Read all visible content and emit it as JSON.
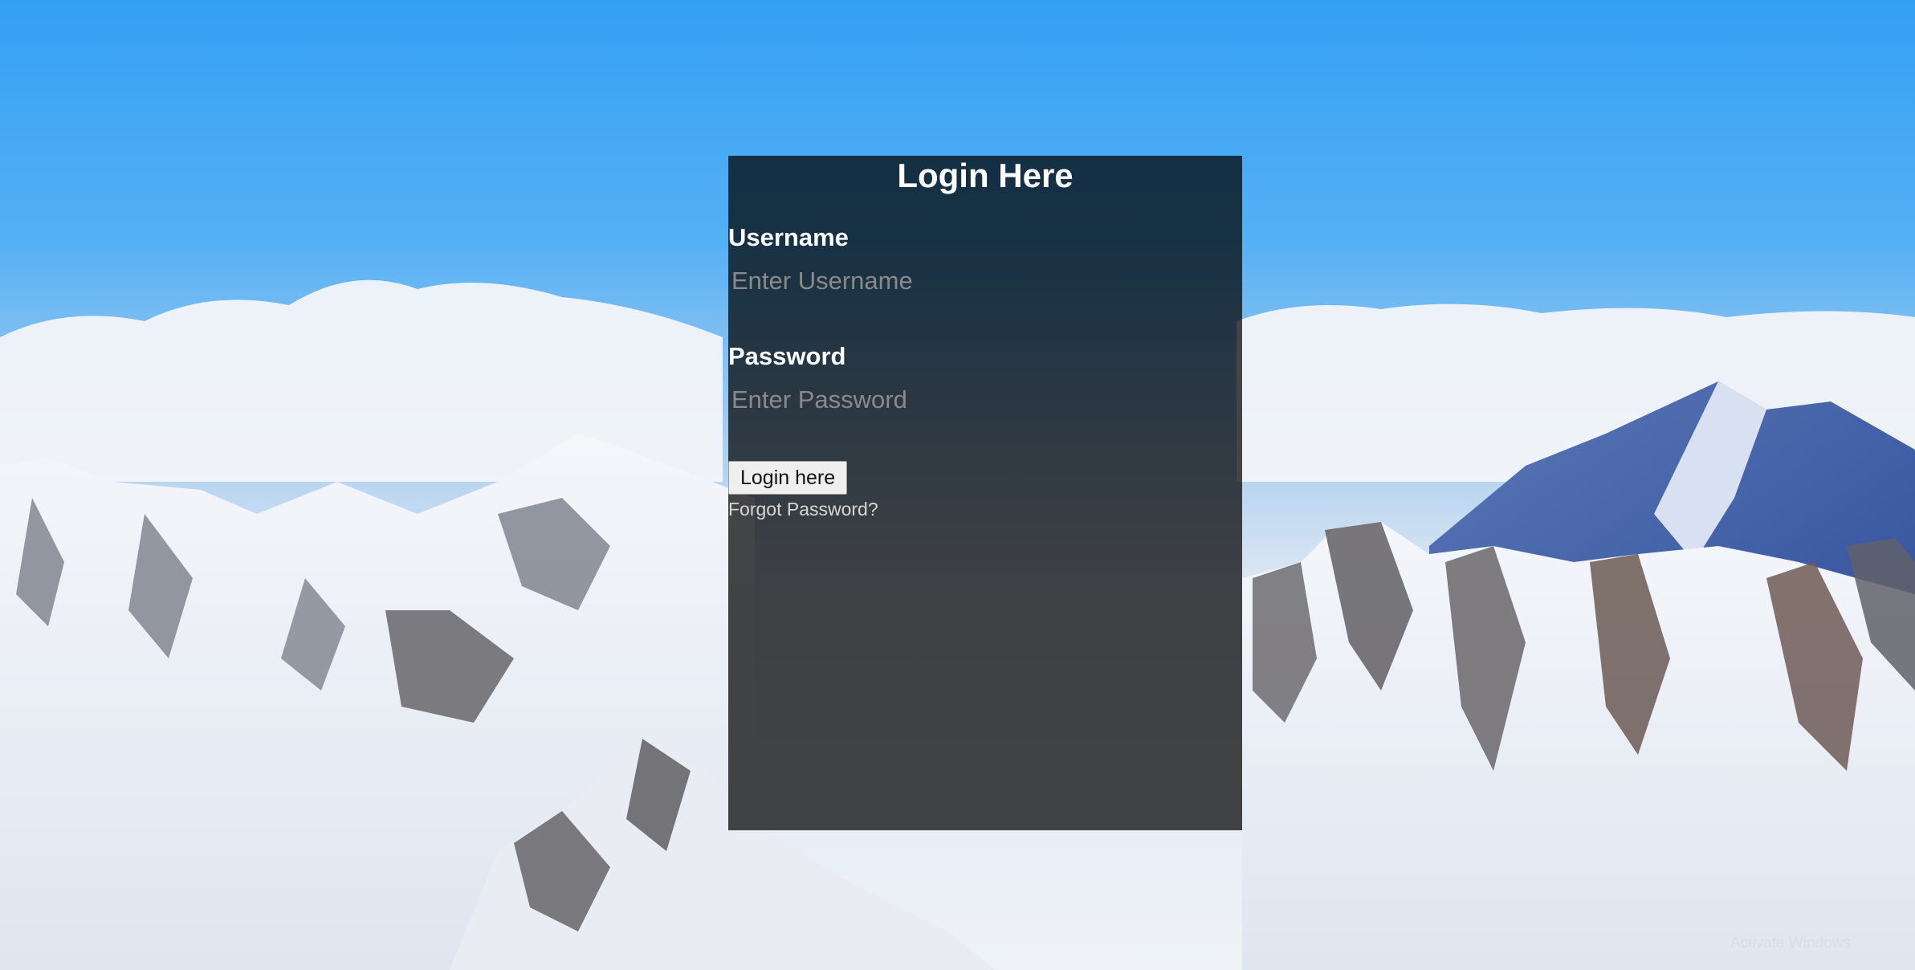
{
  "login": {
    "title": "Login Here",
    "username_label": "Username",
    "username_placeholder": "Enter Username",
    "password_label": "Password",
    "password_placeholder": "Enter Password",
    "submit_label": "Login here",
    "forgot_label": "Forgot Password?"
  },
  "background": {
    "scene": "snowy-mountains-photo",
    "sky_color": "#3aa4f5",
    "panel_color": "#000000"
  },
  "watermark": "Activate Windows"
}
